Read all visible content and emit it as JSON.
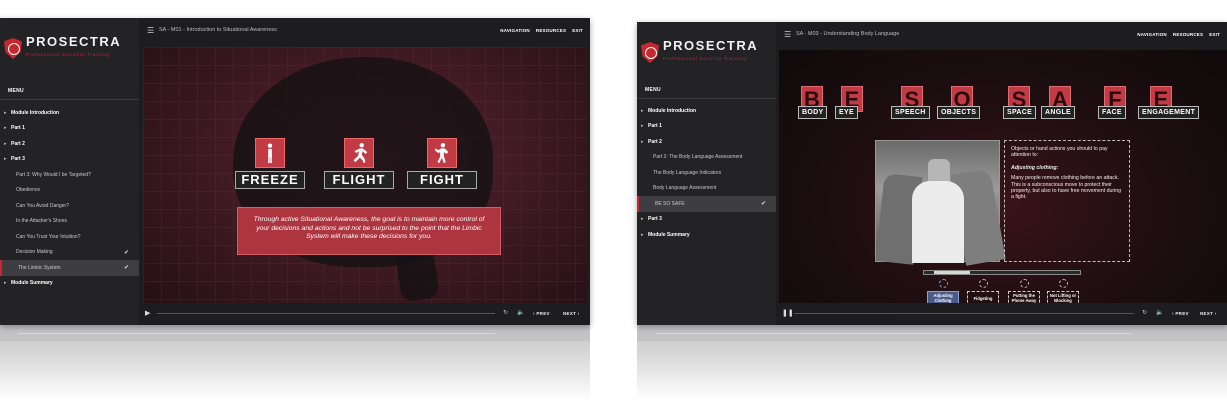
{
  "brand": {
    "name": "PROSECTRA",
    "tagline": "Professional Security Training"
  },
  "nav": {
    "navigation": "NAVIGATION",
    "resources": "RESOURCES",
    "exit": "EXIT"
  },
  "controls": {
    "prev": "PREV",
    "next": "NEXT"
  },
  "colors": {
    "accent": "#c5282f",
    "sidebar": "#232326",
    "panel": "#1d1d1f",
    "selected_option": "#4a5a86"
  },
  "window_a": {
    "breadcrumb": "SA - M01 - Introduction to Situational Awareness",
    "menu_label": "MENU",
    "menu": [
      {
        "label": "Module Introduction",
        "level": "top"
      },
      {
        "label": "Part 1",
        "level": "top"
      },
      {
        "label": "Part 2",
        "level": "top"
      },
      {
        "label": "Part 3",
        "level": "top"
      },
      {
        "label": "Part 3: Why Would I be Targeted?",
        "level": "sub"
      },
      {
        "label": "Obedience",
        "level": "sub"
      },
      {
        "label": "Can You Avoid Danger?",
        "level": "sub"
      },
      {
        "label": "In the Attacker's Shoes",
        "level": "sub"
      },
      {
        "label": "Can You Trust Your Intuition?",
        "level": "sub"
      },
      {
        "label": "Decision Making",
        "level": "sub",
        "checked": "✔"
      },
      {
        "label": "The Limbic System",
        "level": "sub",
        "checked": "✔",
        "active": true
      },
      {
        "label": "Module Summary",
        "level": "top"
      }
    ],
    "actions": [
      "FREEZE",
      "FLIGHT",
      "FIGHT"
    ],
    "message": "Through active Situational Awareness, the goal is to maintain more control of your decisions and actions and not be surprised to the point that the Limbic System will make these decisions for you.",
    "progress": 0.0
  },
  "window_b": {
    "breadcrumb": "SA - M03 - Understanding Body Language",
    "menu_label": "MENU",
    "menu": [
      {
        "label": "Module Introduction",
        "level": "top"
      },
      {
        "label": "Part 1",
        "level": "top"
      },
      {
        "label": "Part 2",
        "level": "top"
      },
      {
        "label": "Part 2: The Body Language Assessment",
        "level": "sub"
      },
      {
        "label": "The Body Language Indicators",
        "level": "sub"
      },
      {
        "label": "Body Language Assessment",
        "level": "sub"
      },
      {
        "label": "BE SO SAFE",
        "level": "sub",
        "checked": "✔",
        "active": true
      },
      {
        "label": "Part 3",
        "level": "top"
      },
      {
        "label": "Module Summary",
        "level": "top"
      }
    ],
    "acronym": [
      {
        "letter": "B",
        "word": "BODY"
      },
      {
        "letter": "E",
        "word": "EYE"
      },
      {
        "letter": "S",
        "word": "SPEECH"
      },
      {
        "letter": "O",
        "word": "OBJECTS"
      },
      {
        "letter": "S",
        "word": "SPACE"
      },
      {
        "letter": "A",
        "word": "ANGLE"
      },
      {
        "letter": "F",
        "word": "FACE"
      },
      {
        "letter": "E",
        "word": "ENGAGEMENT"
      }
    ],
    "info_intro": "Objects or hand actions you should to pay attention to:",
    "info_heading": "Adjusting clothing:",
    "info_body": "Many people remove clothing before an attack. This is a subconscious move to protect their property, but also to have free movement during a fight.",
    "options": [
      {
        "label": "Adjusting Clothing",
        "selected": true
      },
      {
        "label": "Fidgeting"
      },
      {
        "label": "Putting the Phone Away"
      },
      {
        "label": "Not Lifting or Blocking"
      }
    ],
    "slider_position": 0.2,
    "progress": 0.3
  }
}
